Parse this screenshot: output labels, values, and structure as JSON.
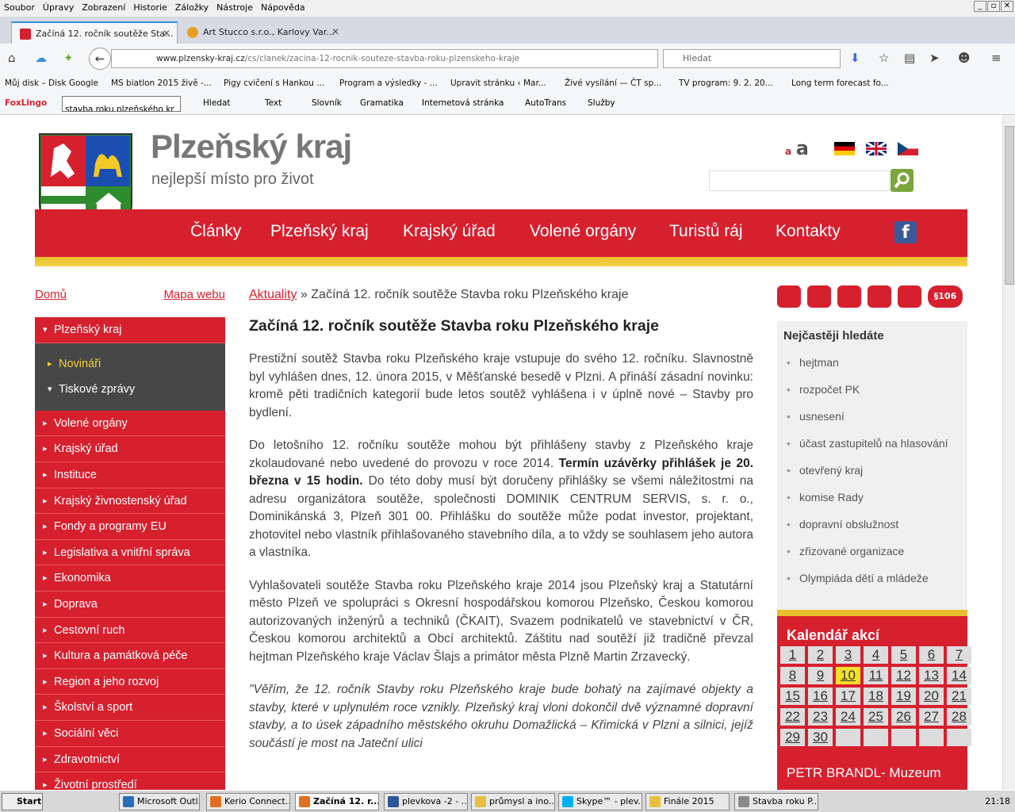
{
  "menu": [
    "Soubor",
    "Úpravy",
    "Zobrazení",
    "Historie",
    "Záložky",
    "Nástroje",
    "Nápověda"
  ],
  "tabs": [
    {
      "label": "Začíná 12. ročník soutěže Sta...",
      "active": true,
      "color": "#d6202e"
    },
    {
      "label": "Art Stucco s.r.o., Karlovy Var...",
      "active": false,
      "color": "#e8a020"
    }
  ],
  "url": {
    "host": "www.plzensky-kraj.cz",
    "path": "/cs/clanek/zacina-12-rocnik-souteze-stavba-roku-plzenskeho-kraje"
  },
  "search_placeholder": "Hledat",
  "bookmarks": [
    "Můj disk – Disk Google",
    "MS biatlon 2015 živě -...",
    "Pigy cvičení s Hankou ...",
    "Program a výsledky - ...",
    "Upravit stránku ‹ Mar...",
    "Živé vysílání — ČT sp...",
    "TV program: 9. 2. 20...",
    "Long term forecast fo..."
  ],
  "foxlingo": {
    "brand": "FoxLingo",
    "input": "stavba roku plzeňského kr",
    "items": [
      "Hledat",
      "Text",
      "Slovník",
      "Gramatika",
      "Internetová stránka",
      "AutoTrans",
      "Služby"
    ]
  },
  "site": {
    "brand": "Plzeňský kraj",
    "slogan": "nejlepší místo pro život",
    "font_small": "a",
    "font_big": "a",
    "nav": [
      "Články",
      "Plzeňský kraj",
      "Krajský úřad",
      "Volené orgány",
      "Turistů ráj",
      "Kontakty"
    ],
    "fb": "f"
  },
  "left": {
    "home": "Domů",
    "sitemap": "Mapa webu",
    "menu": [
      {
        "label": "Plzeňský kraj",
        "type": "open"
      },
      {
        "label": "Novináři",
        "type": "sub-yellow"
      },
      {
        "label": "Tiskové zprávy",
        "type": "sub-open"
      },
      {
        "label": "Volené orgány"
      },
      {
        "label": "Krajský úřad"
      },
      {
        "label": "Instituce"
      },
      {
        "label": "Krajský živnostenský úřad"
      },
      {
        "label": "Fondy a programy EU"
      },
      {
        "label": "Legislativa a vnitřní správa"
      },
      {
        "label": "Ekonomika"
      },
      {
        "label": "Doprava"
      },
      {
        "label": "Cestovní ruch"
      },
      {
        "label": "Kultura a památková péče"
      },
      {
        "label": "Region a jeho rozvoj"
      },
      {
        "label": "Školství a sport"
      },
      {
        "label": "Sociální věci"
      },
      {
        "label": "Zdravotnictví"
      },
      {
        "label": "Životní prostředí"
      }
    ]
  },
  "article": {
    "crumb_link": "Aktuality",
    "crumb_sep": " » ",
    "crumb_current": "Začíná 12. ročník soutěže Stavba roku Plzeňského kraje",
    "title": "Začíná 12. ročník soutěže Stavba roku Plzeňského kraje",
    "p1": "Prestižní soutěž Stavba roku Plzeňského kraje vstupuje do svého 12. ročníku. Slavnostně byl vyhlášen dnes, 12. února 2015, v Měšťanské besedě v Plzni. A přináší zásadní novinku: kromě pěti tradičních kategorií bude letos soutěž vyhlášena i v úplně nové – Stavby pro bydlení.",
    "p2a": "Do letošního 12. ročníku soutěže mohou být přihlášeny stavby z Plzeňského kraje zkolaudované nebo uvedené do provozu v roce 2014. ",
    "p2b": "Termín uzávěrky přihlášek je 20. března v 15 hodin.",
    "p2c": " Do této doby musí být doručeny přihlášky se všemi náležitostmi na adresu organizátora soutěže, společnosti DOMINIK CENTRUM SERVIS, s. r. o., Dominikánská 3, Plzeň 301 00. Přihlášku do soutěže může podat investor, projektant, zhotovitel nebo vlastník přihlašovaného stavebního díla, a to vždy se souhlasem jeho autora a vlastníka.",
    "p3": "Vyhlašovateli soutěže Stavba roku Plzeňského kraje 2014 jsou Plzeňský kraj a Statutární město Plzeň ve spolupráci s Okresní hospodářskou komorou Plzeňsko, Českou komorou autorizovaných inženýrů a techniků (ČKAIT), Svazem podnikatelů ve stavebnictví v ČR, Českou komorou architektů a Obcí architektů. Záštitu nad soutěží již tradičně převzal hejtman Plzeňského kraje Václav Šlajs a primátor města Plzně Martin Zrzavecký.",
    "p4": "\"Věřím, že 12. ročník Stavby roku Plzeňského kraje bude bohatý na zajímavé objekty a stavby, které v uplynulém roce vznikly. Plzeňský kraj vloni dokončil dvě významné dopravní stavby, a to úsek západního městského okruhu Domažlická – Křimická v Plzni a silnici, jejíž součástí je most na Jateční ulici"
  },
  "popular": {
    "title": "Nejčastěji hledáte",
    "items": [
      "hejtman",
      "rozpočet PK",
      "usnesení",
      "účast zastupitelů na hlasování",
      "otevřený kraj",
      "komise Rady",
      "dopravní obslužnost",
      "zřizované organizace",
      "Olympiáda dětí a mládeže"
    ]
  },
  "badge": "§106",
  "calendar": {
    "title": "Kalendář akcí",
    "days": [
      "1",
      "2",
      "3",
      "4",
      "5",
      "6",
      "7",
      "8",
      "9",
      "10",
      "11",
      "12",
      "13",
      "14",
      "15",
      "16",
      "17",
      "18",
      "19",
      "20",
      "21",
      "22",
      "23",
      "24",
      "25",
      "26",
      "27",
      "28",
      "29",
      "30",
      "",
      "",
      "",
      "",
      ""
    ],
    "today": "10",
    "event": "PETR BRANDL- Muzeum"
  },
  "taskbar": {
    "start": "Start",
    "tasks": [
      "Microsoft Outl...",
      "Kerio Connect...",
      "Začíná 12. r...",
      "plevkova -2 - ...",
      "průmysl a ino...",
      "Skype™ - plev...",
      "Finále 2015",
      "Stavba roku P..."
    ],
    "clock": "21:18"
  }
}
